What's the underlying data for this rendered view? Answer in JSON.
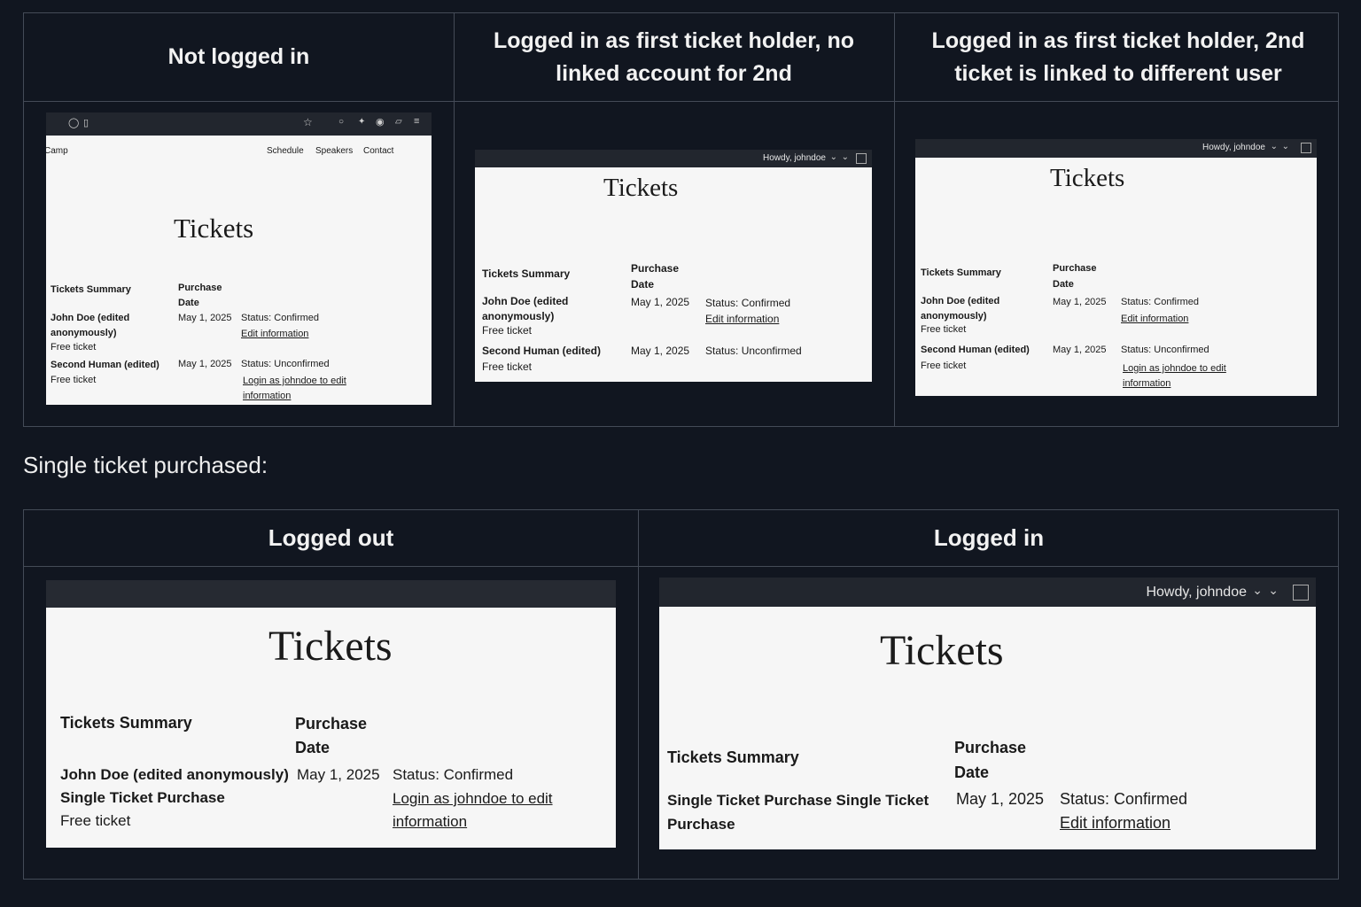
{
  "top_grid": {
    "headers": [
      "Not logged in",
      "Logged in as first ticket holder, no linked account for 2nd",
      "Logged in as first ticket holder, 2nd ticket is linked to different user"
    ]
  },
  "panel1": {
    "site_name": "Camp",
    "nav": [
      "Schedule",
      "Speakers",
      "Contact"
    ],
    "title": "Tickets",
    "col_summary": "Tickets Summary",
    "col_date": "Purchase Date",
    "rows": [
      {
        "name": "John Doe (edited anonymously)",
        "type": "Free ticket",
        "date": "May 1, 2025",
        "status": "Status: Confirmed",
        "action": "Edit information"
      },
      {
        "name": "Second Human (edited)",
        "type": "Free ticket",
        "date": "May 1, 2025",
        "status": "Status: Unconfirmed",
        "action": "Login as johndoe to edit information"
      }
    ]
  },
  "panel2": {
    "greeting": "Howdy, johndoe",
    "title": "Tickets",
    "col_summary": "Tickets Summary",
    "col_date": "Purchase Date",
    "rows": [
      {
        "name": "John Doe (edited anonymously)",
        "type": "Free ticket",
        "date": "May 1, 2025",
        "status": "Status: Confirmed",
        "action": "Edit information"
      },
      {
        "name": "Second Human (edited)",
        "type": "Free ticket",
        "date": "May 1, 2025",
        "status": "Status: Unconfirmed"
      }
    ]
  },
  "panel3": {
    "greeting": "Howdy, johndoe",
    "title": "Tickets",
    "col_summary": "Tickets Summary",
    "col_date": "Purchase Date",
    "rows": [
      {
        "name": "John Doe (edited anonymously)",
        "type": "Free ticket",
        "date": "May 1, 2025",
        "status": "Status: Confirmed",
        "action": "Edit information"
      },
      {
        "name": "Second Human (edited)",
        "type": "Free ticket",
        "date": "May 1, 2025",
        "status": "Status: Unconfirmed",
        "action": "Login as johndoe to edit information"
      }
    ]
  },
  "section_label": "Single ticket purchased:",
  "bottom_grid": {
    "headers": [
      "Logged out",
      "Logged in"
    ]
  },
  "panel4": {
    "title": "Tickets",
    "col_summary": "Tickets Summary",
    "col_date": "Purchase Date",
    "row": {
      "name": "John Doe (edited anonymously)",
      "subname": "Single Ticket Purchase",
      "type": "Free ticket",
      "date": "May 1, 2025",
      "status": "Status: Confirmed",
      "action": "Login as johndoe to edit information"
    }
  },
  "panel5": {
    "greeting": "Howdy, johndoe",
    "title": "Tickets",
    "col_summary": "Tickets Summary",
    "col_date": "Purchase Date",
    "row": {
      "name": "Single Ticket Purchase Single Ticket Purchase",
      "date": "May 1, 2025",
      "status": "Status: Confirmed",
      "action": "Edit information"
    }
  },
  "icons": [
    "shield-icon",
    "lock-icon",
    "star-icon",
    "pocket-icon",
    "wrench-icon",
    "account-icon",
    "extension-icon",
    "menu-icon",
    "chevron-down-icon",
    "sidebar-toggle-icon"
  ]
}
